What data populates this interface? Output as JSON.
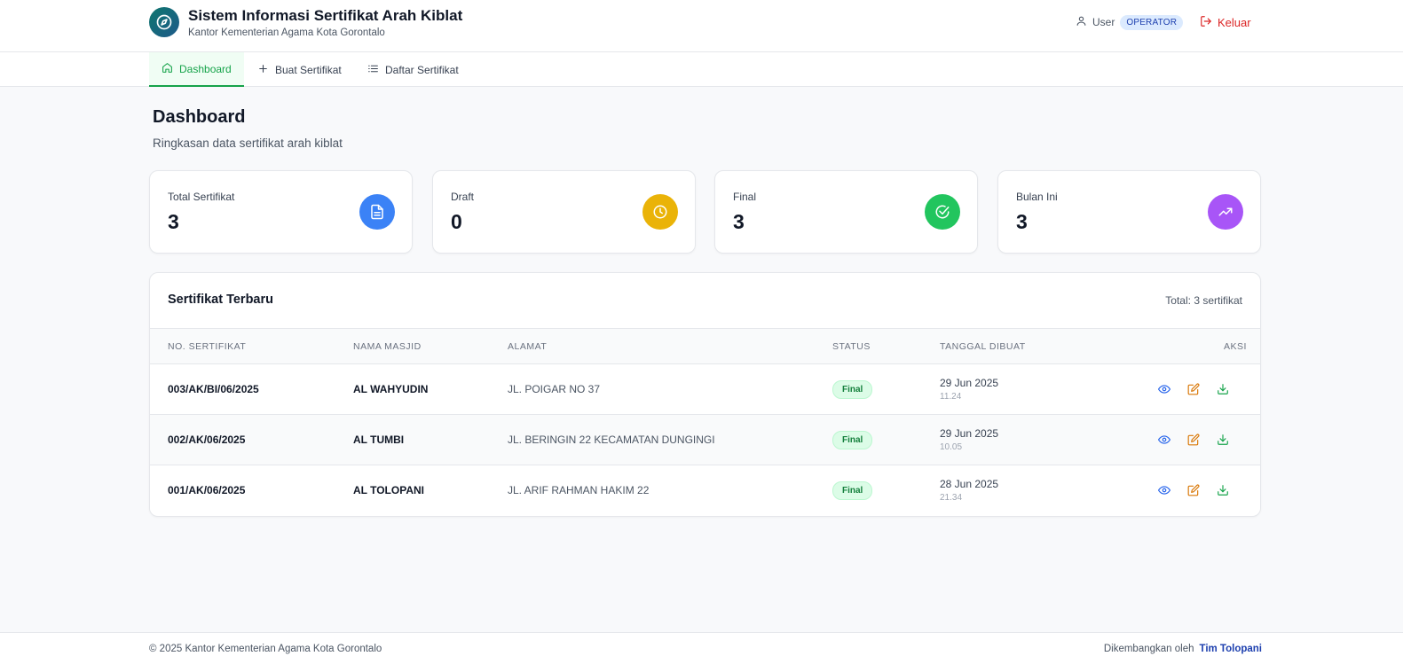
{
  "header": {
    "title": "Sistem Informasi Sertifikat Arah Kiblat",
    "subtitle": "Kantor Kementerian Agama Kota Gorontalo",
    "logo_icon": "compass-icon",
    "user_label": "User",
    "role_badge": "OPERATOR",
    "logout_label": "Keluar",
    "accent": "#16a34a",
    "danger": "#dc2626"
  },
  "nav": {
    "tabs": [
      {
        "label": "Dashboard",
        "icon": "home-icon",
        "active": true
      },
      {
        "label": "Buat Sertifikat",
        "icon": "plus-icon",
        "active": false
      },
      {
        "label": "Daftar Sertifikat",
        "icon": "list-icon",
        "active": false
      }
    ]
  },
  "page": {
    "title": "Dashboard",
    "subtitle": "Ringkasan data sertifikat arah kiblat"
  },
  "stats": [
    {
      "label": "Total Sertifikat",
      "value": "3",
      "icon": "document-icon",
      "color": "#3b82f6"
    },
    {
      "label": "Draft",
      "value": "0",
      "icon": "clock-icon",
      "color": "#eab308"
    },
    {
      "label": "Final",
      "value": "3",
      "icon": "check-circle-icon",
      "color": "#22c55e"
    },
    {
      "label": "Bulan Ini",
      "value": "3",
      "icon": "trending-up-icon",
      "color": "#a855f7"
    }
  ],
  "recent": {
    "title": "Sertifikat Terbaru",
    "total": "Total: 3 sertifikat",
    "columns": [
      "NO. SERTIFIKAT",
      "NAMA MASJID",
      "ALAMAT",
      "STATUS",
      "TANGGAL DIBUAT",
      "AKSI"
    ],
    "rows": [
      {
        "number": "003/AK/BI/06/2025",
        "mosque": "AL WAHYUDIN",
        "address": "JL. POIGAR NO 37",
        "status": "Final",
        "date": "29 Jun 2025",
        "time": "11.24"
      },
      {
        "number": "002/AK/06/2025",
        "mosque": "AL TUMBI",
        "address": "JL. BERINGIN 22 KECAMATAN DUNGINGI",
        "status": "Final",
        "date": "29 Jun 2025",
        "time": "10.05"
      },
      {
        "number": "001/AK/06/2025",
        "mosque": "AL TOLOPANI",
        "address": "JL. ARIF RAHMAN HAKIM 22",
        "status": "Final",
        "date": "28 Jun 2025",
        "time": "21.34"
      }
    ],
    "actions": [
      "eye-icon",
      "edit-icon",
      "download-icon"
    ]
  },
  "footer": {
    "copyright": "© 2025 Kantor Kementerian Agama Kota Gorontalo",
    "dev_prefix": "Dikembangkan oleh",
    "dev_name": "Tim Tolopani"
  }
}
